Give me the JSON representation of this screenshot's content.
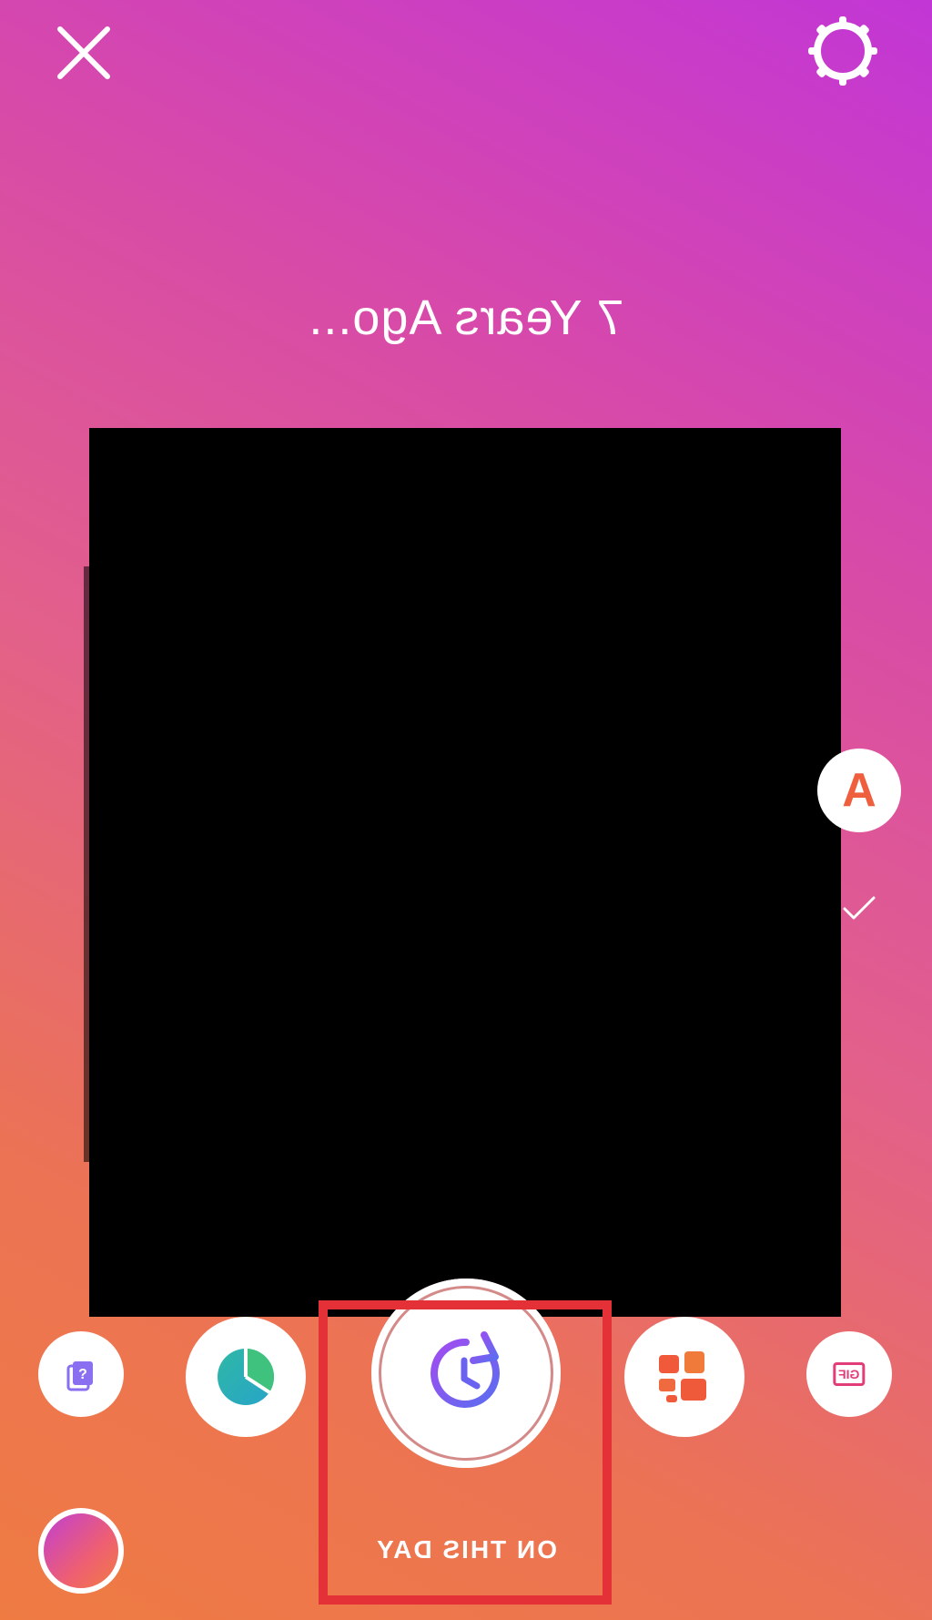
{
  "screen": {
    "title": "7 Years Ago...",
    "text_tool_label": "A"
  },
  "stickers": {
    "on_this_day_label": "ON THIS DAY",
    "gif_label": "GIF",
    "quiz_label": "?"
  },
  "icons": {
    "close": "close-icon",
    "settings": "gear-icon",
    "check": "check-icon",
    "on_this_day": "history-clock-icon",
    "stats": "pie-chart-icon",
    "layout": "layout-grid-icon",
    "quiz": "question-cards-icon"
  },
  "colors": {
    "highlight": "#e43138",
    "accent_purple": "#7a5cf0",
    "accent_orange": "#ef5f3e"
  }
}
